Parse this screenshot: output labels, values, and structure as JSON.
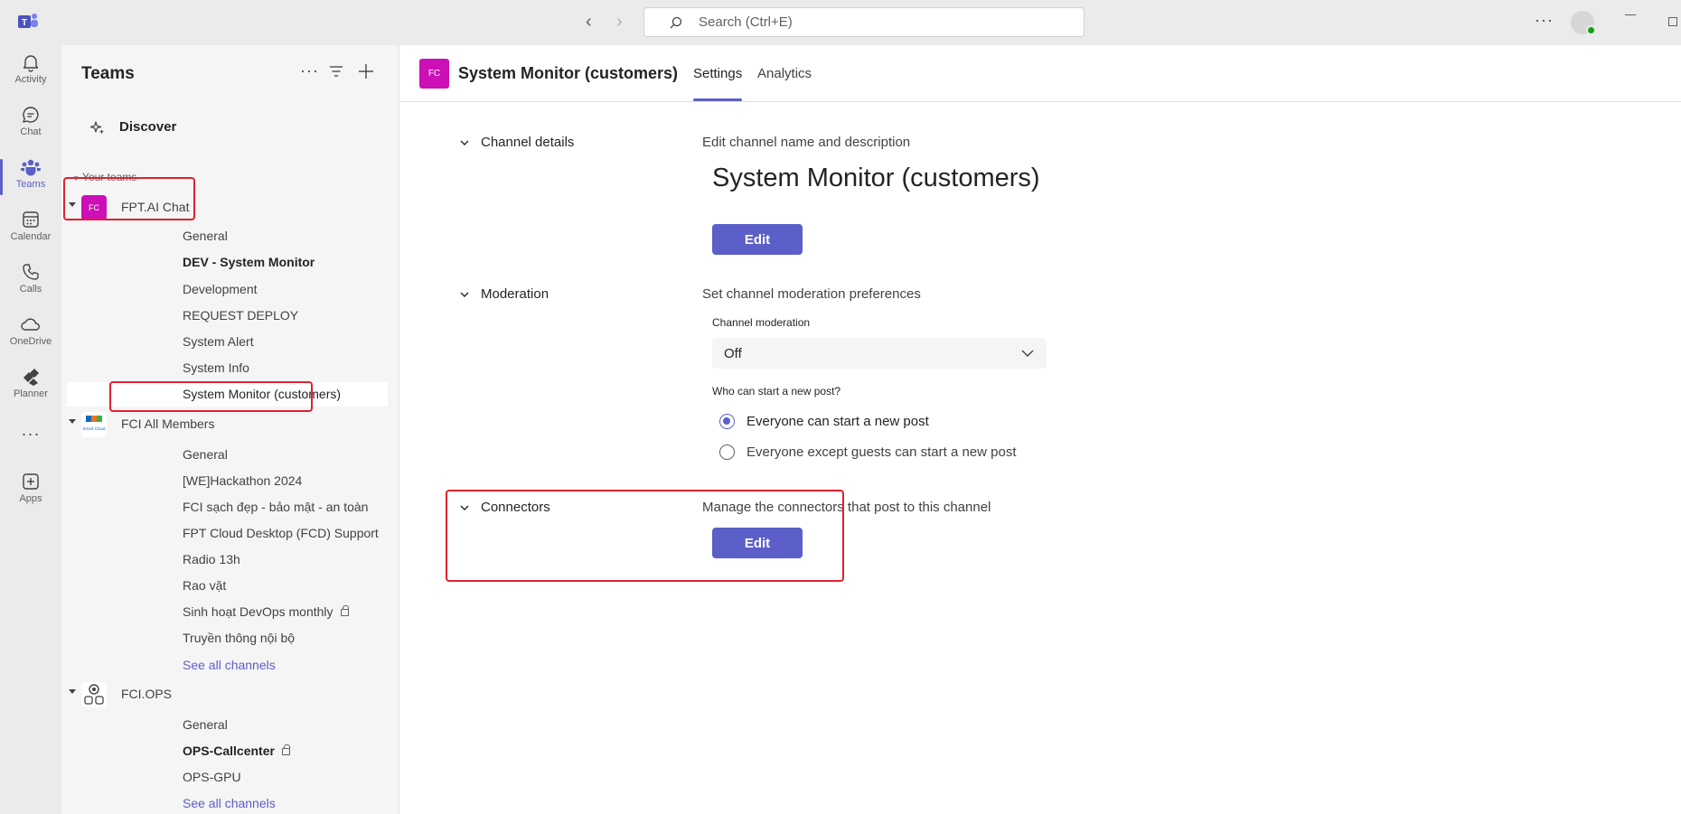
{
  "titlebar": {
    "search_placeholder": "Search (Ctrl+E)"
  },
  "rail": {
    "items": [
      {
        "label": "Activity",
        "icon": "bell-icon"
      },
      {
        "label": "Chat",
        "icon": "chat-icon"
      },
      {
        "label": "Teams",
        "icon": "teams-icon"
      },
      {
        "label": "Calendar",
        "icon": "calendar-icon"
      },
      {
        "label": "Calls",
        "icon": "phone-icon"
      },
      {
        "label": "OneDrive",
        "icon": "cloud-icon"
      },
      {
        "label": "Planner",
        "icon": "planner-icon"
      },
      {
        "label": "Apps",
        "icon": "add-app-icon"
      }
    ],
    "active": "Teams"
  },
  "sidepane": {
    "title": "Teams",
    "discover": "Discover",
    "your_teams": "Your teams",
    "teams": [
      {
        "name": "FPT.AI Chat",
        "avatar_text": "FC",
        "avatar_color": "#cc0fb6",
        "channels": [
          "General",
          "DEV - System Monitor",
          "Development",
          "REQUEST DEPLOY",
          "System Alert",
          "System Info",
          "System Monitor (customers)"
        ]
      },
      {
        "name": "FCI All Members",
        "avatar_text": "Smart Cloud",
        "channels": [
          "General",
          "[WE]Hackathon 2024",
          "FCI sạch đẹp - bảo mật - an toàn",
          "FPT Cloud Desktop (FCD) Support",
          "Radio 13h",
          "Rao vặt",
          "Sinh hoạt DevOps monthly",
          "Truyền thông nội bộ"
        ],
        "see_all": "See all channels"
      },
      {
        "name": "FCI.OPS",
        "channels": [
          "General",
          "OPS-Callcenter",
          "OPS-GPU"
        ],
        "see_all": "See all channels"
      }
    ]
  },
  "header": {
    "avatar_text": "FC",
    "channel_name": "System Monitor (customers)",
    "tabs": [
      "Settings",
      "Analytics"
    ],
    "active_tab": "Settings"
  },
  "settings": {
    "channel_details": {
      "title": "Channel details",
      "description": "Edit channel name and description",
      "name": "System Monitor (customers)",
      "button": "Edit"
    },
    "moderation": {
      "title": "Moderation",
      "description": "Set channel moderation preferences",
      "channel_moderation_label": "Channel moderation",
      "channel_moderation_value": "Off",
      "who_can_post_label": "Who can start a new post?",
      "options": [
        "Everyone can start a new post",
        "Everyone except guests can start a new post"
      ],
      "selected_option": "Everyone can start a new post"
    },
    "connectors": {
      "title": "Connectors",
      "description": "Manage the connectors that post to this channel",
      "button": "Edit"
    }
  },
  "colors": {
    "accent": "#5b5fc7",
    "annotation": "#e0202e",
    "team_avatar": "#cc0fb6"
  }
}
